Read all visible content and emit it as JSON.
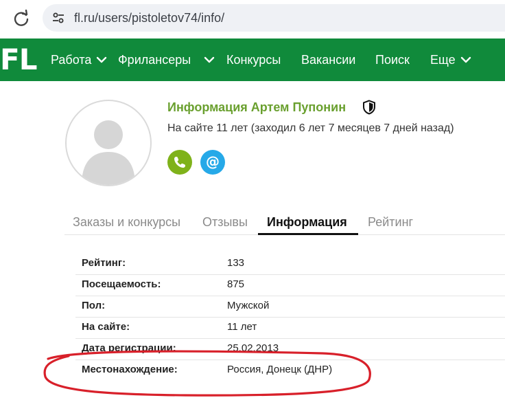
{
  "browser": {
    "url": "fl.ru/users/pistoletov74/info/"
  },
  "nav": {
    "logo": "FL",
    "items": [
      {
        "label": "Работа",
        "has_menu": true
      },
      {
        "label": "Фрилансеры",
        "has_menu": true
      },
      {
        "label": "Конкурсы",
        "has_menu": false
      },
      {
        "label": "Вакансии",
        "has_menu": false
      },
      {
        "label": "Поиск",
        "has_menu": false
      },
      {
        "label": "Еще",
        "has_menu": true
      }
    ],
    "color": "#108a3b"
  },
  "profile": {
    "title": "Информация Артем Пупонин",
    "on_site": "На сайте 11 лет (заходил 6 лет 7 месяцев 7 дней назад)",
    "title_color": "#6aa02f",
    "contact_buttons": [
      "phone-icon",
      "email-icon"
    ],
    "email_glyph": "@"
  },
  "tabs": [
    {
      "label": "Заказы и конкурсы",
      "active": false
    },
    {
      "label": "Отзывы",
      "active": false
    },
    {
      "label": "Информация",
      "active": true
    },
    {
      "label": "Рейтинг",
      "active": false
    }
  ],
  "info": [
    {
      "label": "Рейтинг:",
      "value": "133"
    },
    {
      "label": "Посещаемость:",
      "value": "875"
    },
    {
      "label": "Пол:",
      "value": "Мужской"
    },
    {
      "label": "На сайте:",
      "value": "11 лет"
    },
    {
      "label": "Дата регистрации:",
      "value": "25.02.2013"
    },
    {
      "label": "Местонахождение:",
      "value": "Россия, Донецк (ДНР)"
    }
  ],
  "annotation": {
    "color": "#d8202a"
  }
}
